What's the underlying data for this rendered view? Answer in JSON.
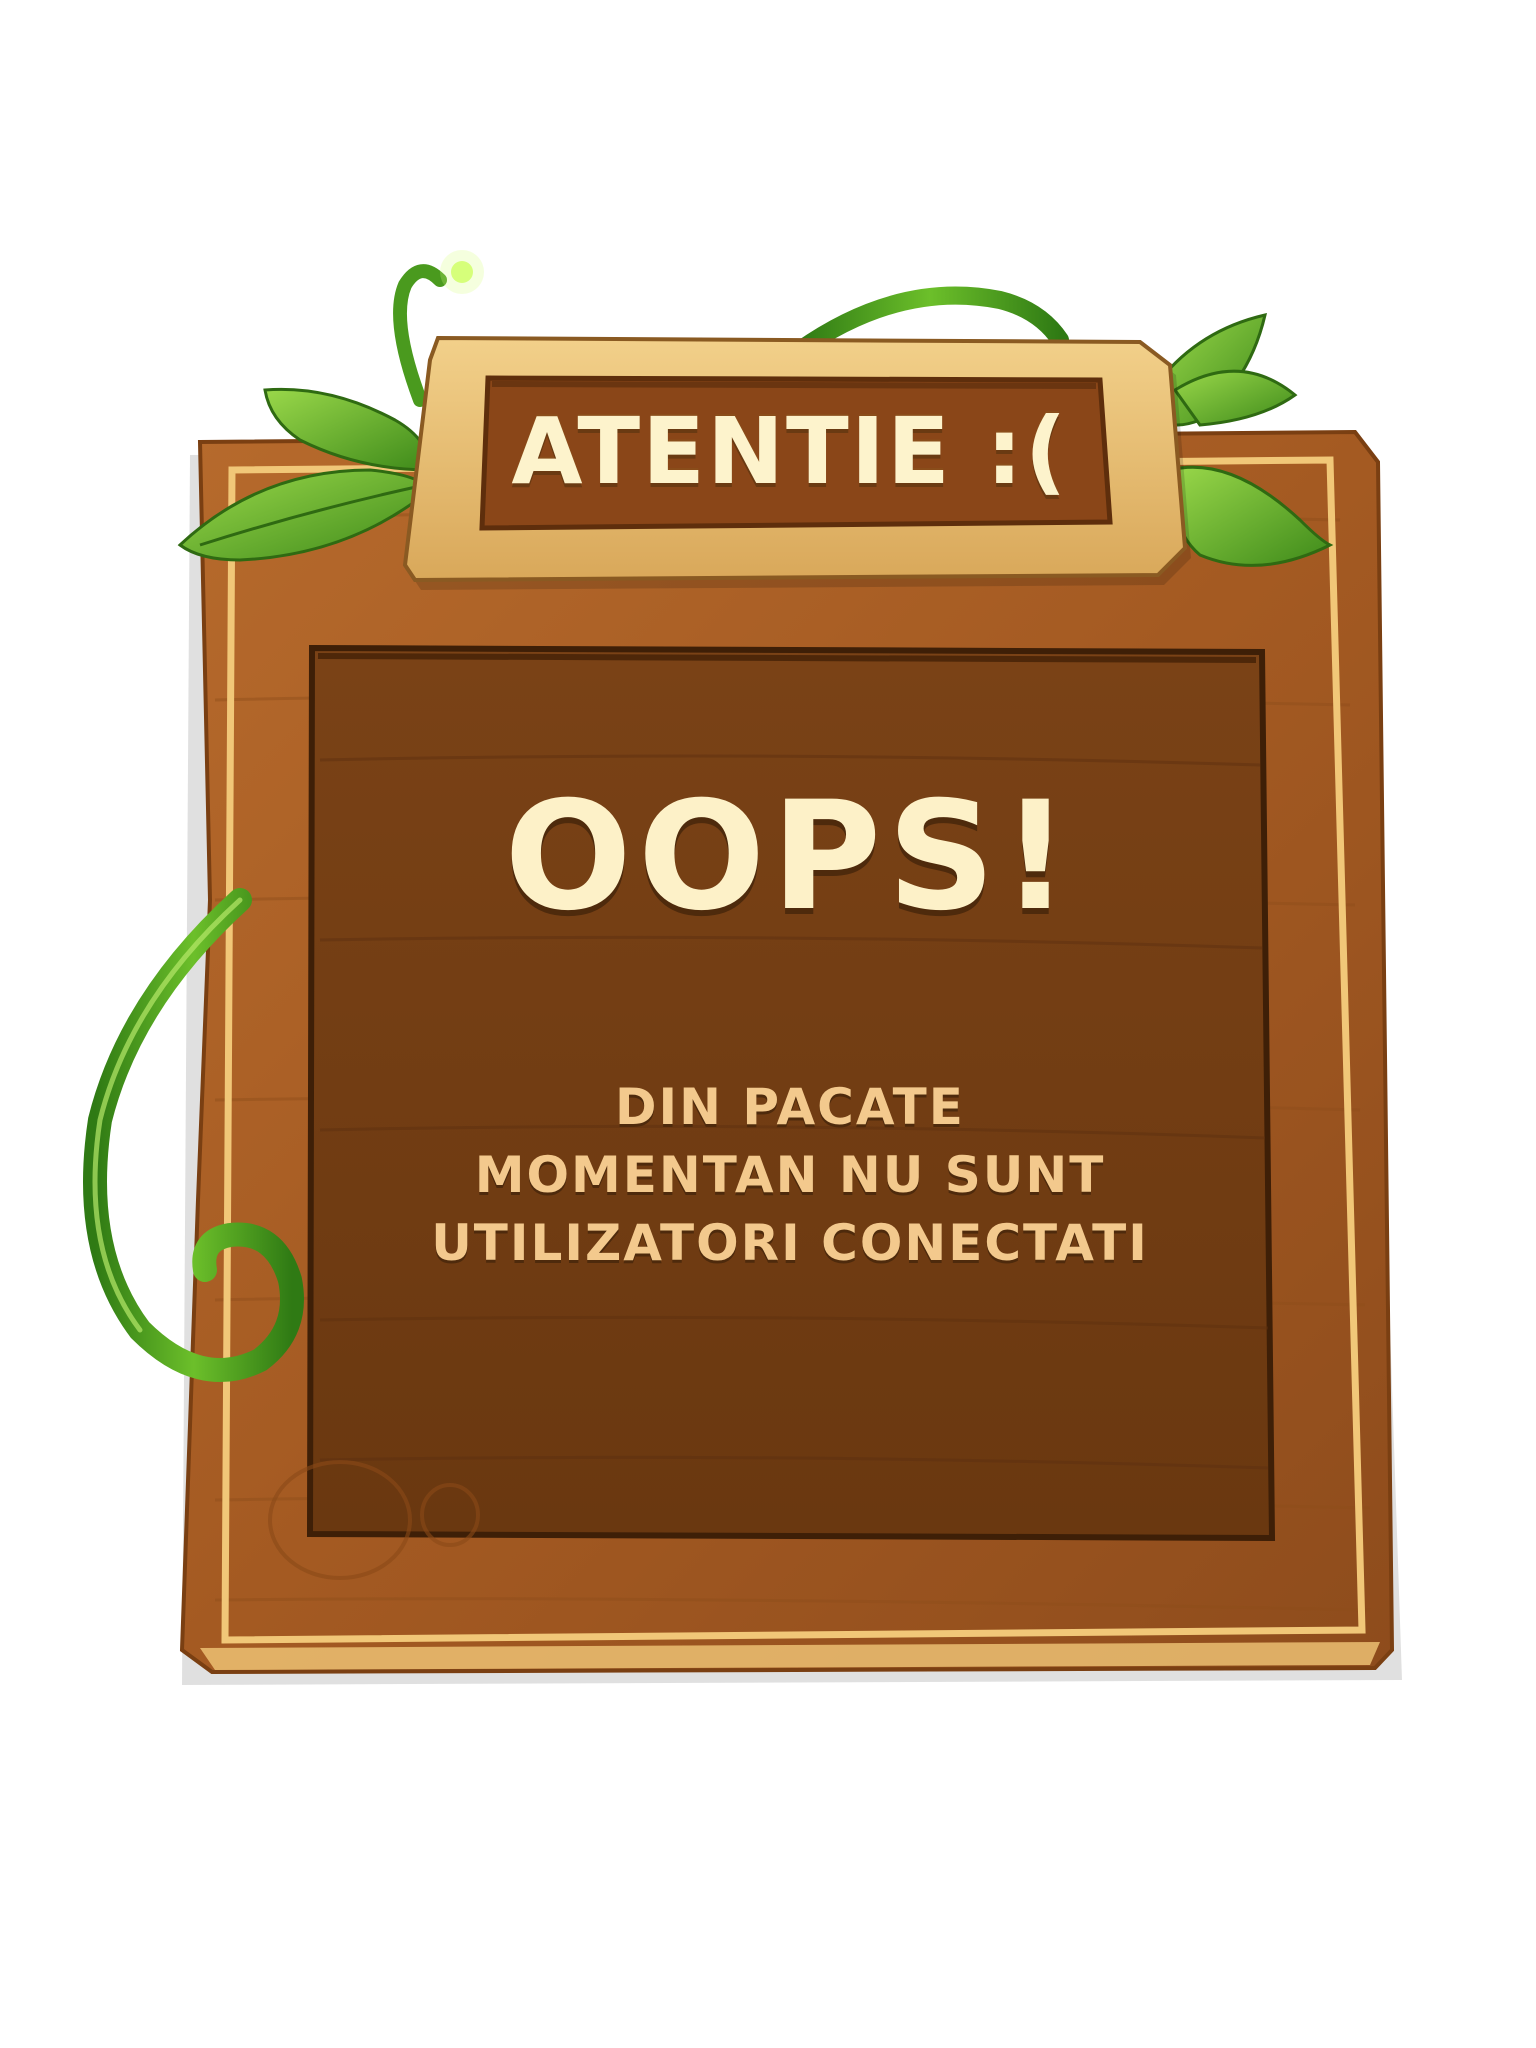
{
  "sign": {
    "title": "ATENTIE :("
  },
  "panel": {
    "headline": "OOPS!",
    "message_lines": [
      "DIN PACATE",
      "MOMENTAN NU SUNT",
      "UTILIZATORI CONECTATI"
    ]
  },
  "colors": {
    "wood_outer": "#a85e26",
    "wood_inner": "#6e3a12",
    "trim": "#f1c778",
    "vine": "#4a9a1e",
    "text_cream": "#fdf1c8",
    "text_tan": "#f3c98d"
  },
  "icons": {
    "vine": "vine-icon",
    "leaves": "leaf-icon"
  }
}
